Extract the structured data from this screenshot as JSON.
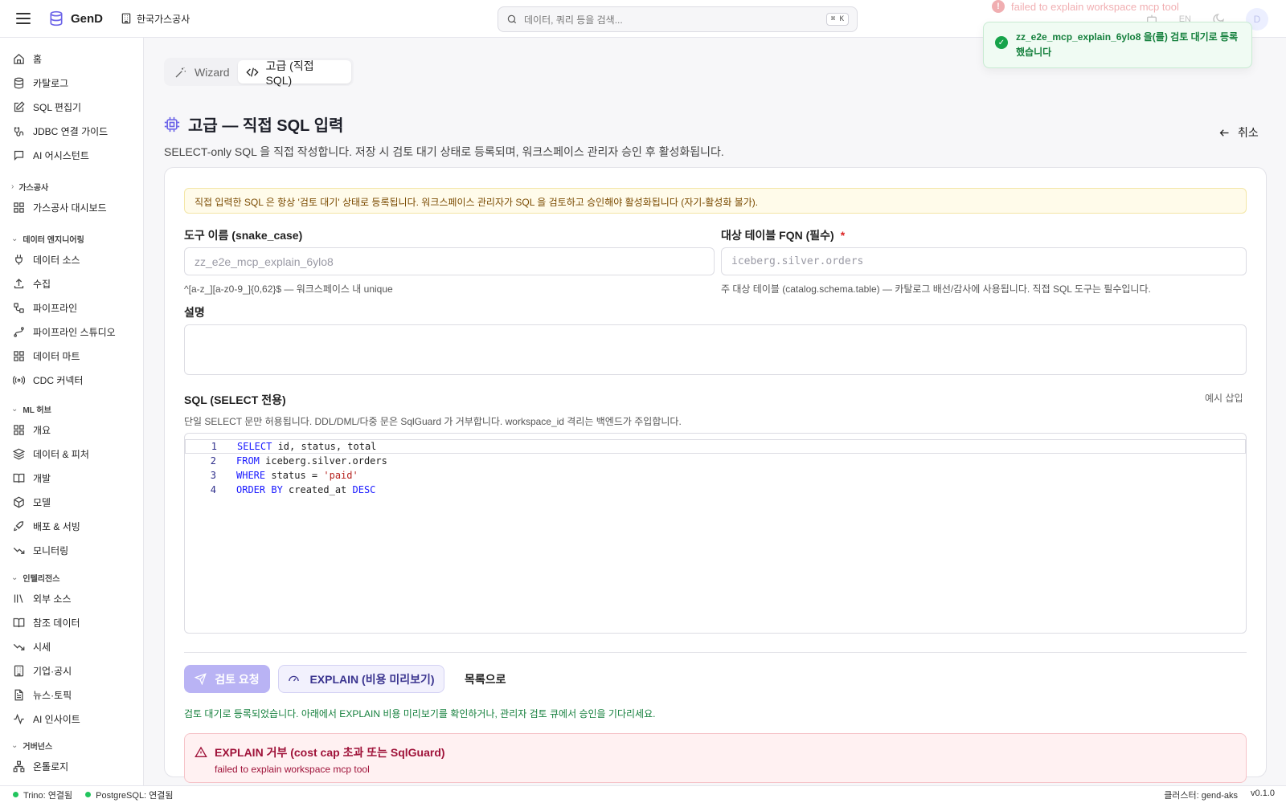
{
  "app": {
    "name": "GenD",
    "org": "한국가스공사"
  },
  "search": {
    "placeholder": "데이터, 쿼리 등을 검색...",
    "shortcut": "⌘ K"
  },
  "header": {
    "lang": "EN",
    "avatar": "D"
  },
  "toast": {
    "ghost_error": "failed to explain workspace mcp tool",
    "success": "zz_e2e_mcp_explain_6ylo8 을(를) 검토 대기로 등록했습니다"
  },
  "sidebar": {
    "items": [
      {
        "label": "홈",
        "icon": "home-icon"
      },
      {
        "label": "카탈로그",
        "icon": "database-icon"
      },
      {
        "label": "SQL 편집기",
        "icon": "edit-icon"
      },
      {
        "label": "JDBC 연결 가이드",
        "icon": "plug-cable-icon"
      },
      {
        "label": "AI 어시스턴트",
        "icon": "chat-icon"
      }
    ],
    "sections": [
      {
        "title": "가스공사",
        "collapsed": true,
        "items": [
          {
            "label": "가스공사 대시보드",
            "icon": "dashboard-icon"
          }
        ]
      },
      {
        "title": "데이터 엔지니어링",
        "items": [
          {
            "label": "데이터 소스",
            "icon": "plug-icon"
          },
          {
            "label": "수집",
            "icon": "upload-icon"
          },
          {
            "label": "파이프라인",
            "icon": "workflow-icon"
          },
          {
            "label": "파이프라인 스튜디오",
            "icon": "spline-icon"
          },
          {
            "label": "데이터 마트",
            "icon": "grid-icon"
          },
          {
            "label": "CDC 커넥터",
            "icon": "radio-icon"
          }
        ]
      },
      {
        "title": "ML 허브",
        "items": [
          {
            "label": "개요",
            "icon": "grid-icon"
          },
          {
            "label": "데이터 & 피처",
            "icon": "layers-icon"
          },
          {
            "label": "개발",
            "icon": "book-open-icon"
          },
          {
            "label": "모델",
            "icon": "box-icon"
          },
          {
            "label": "배포 & 서빙",
            "icon": "rocket-icon"
          },
          {
            "label": "모니터링",
            "icon": "trending-down-icon"
          }
        ]
      },
      {
        "title": "인텔리전스",
        "items": [
          {
            "label": "외부 소스",
            "icon": "library-icon"
          },
          {
            "label": "참조 데이터",
            "icon": "book-open-icon"
          },
          {
            "label": "시세",
            "icon": "trending-down-icon"
          },
          {
            "label": "기업·공시",
            "icon": "building-icon"
          },
          {
            "label": "뉴스·토픽",
            "icon": "file-text-icon"
          },
          {
            "label": "AI 인사이트",
            "icon": "activity-icon"
          }
        ]
      },
      {
        "title": "거버넌스",
        "items": [
          {
            "label": "온톨로지",
            "icon": "network-icon"
          }
        ]
      }
    ]
  },
  "mode": {
    "tabs": [
      "Wizard",
      "고급 (직접 SQL)"
    ],
    "active": 1
  },
  "page": {
    "title": "고급 — 직접 SQL 입력",
    "subtitle": "SELECT-only SQL 을 직접 작성합니다. 저장 시 검토 대기 상태로 등록되며, 워크스페이스 관리자 승인 후 활성화됩니다.",
    "cancel": "취소"
  },
  "form": {
    "notice": "직접 입력한 SQL 은 항상 '검토 대기' 상태로 등록됩니다. 워크스페이스 관리자가 SQL 을 검토하고 승인해야 활성화됩니다 (자기-활성화 불가).",
    "tool_name": {
      "label": "도구 이름 (snake_case)",
      "value": "zz_e2e_mcp_explain_6ylo8",
      "hint": "^[a-z_][a-z0-9_]{0,62}$ — 워크스페이스 내 unique"
    },
    "table_fqn": {
      "label": "대상 테이블 FQN (필수)",
      "required_mark": "*",
      "placeholder": "iceberg.silver.orders",
      "hint": "주 대상 테이블 (catalog.schema.table) — 카탈로그 배선/감사에 사용됩니다. 직접 SQL 도구는 필수입니다."
    },
    "description": {
      "label": "설명",
      "value": ""
    },
    "sql": {
      "label": "SQL (SELECT 전용)",
      "example_button": "예시 삽입",
      "hint": "단일 SELECT 문만 허용됩니다. DDL/DML/다중 문은 SqlGuard 가 거부합니다. workspace_id 격리는 백엔드가 주입합니다.",
      "lines": [
        {
          "no": "1",
          "kw1": "SELECT",
          "t1": " id, status, total",
          "str": "",
          "kw2": ""
        },
        {
          "no": "2",
          "kw1": "FROM",
          "t1": " iceberg.silver.orders",
          "str": "",
          "kw2": ""
        },
        {
          "no": "3",
          "kw1": "WHERE",
          "t1": " status = ",
          "str": "'paid'",
          "kw2": ""
        },
        {
          "no": "4",
          "kw1": "ORDER BY",
          "t1": " created_at ",
          "str": "",
          "kw2": "DESC"
        }
      ]
    }
  },
  "actions": {
    "submit": "검토 요청",
    "explain": "EXPLAIN (비용 미리보기)",
    "back": "목록으로"
  },
  "result": {
    "success": "검토 대기로 등록되었습니다. 아래에서 EXPLAIN 비용 미리보기를 확인하거나, 관리자 검토 큐에서 승인을 기다리세요.",
    "error_title": "EXPLAIN 거부 (cost cap 초과 또는 SqlGuard)",
    "error_detail": "failed to explain workspace mcp tool"
  },
  "statusbar": {
    "trino": "Trino: 연결됨",
    "postgres": "PostgreSQL: 연결됨",
    "cluster": "클러스터: gend-aks",
    "version": "v0.1.0"
  },
  "colors": {
    "accent": "#6b63e8",
    "success": "#16a34a",
    "error": "#e04e55"
  }
}
